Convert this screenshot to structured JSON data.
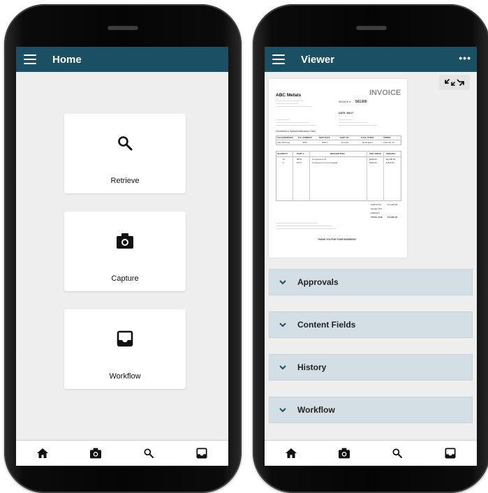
{
  "left_phone": {
    "appbar": {
      "title": "Home"
    },
    "tiles": [
      {
        "label": "Retrieve",
        "icon": "search-icon"
      },
      {
        "label": "Capture",
        "icon": "camera-icon"
      },
      {
        "label": "Workflow",
        "icon": "inbox-icon"
      }
    ],
    "bottom_nav": [
      "home-icon",
      "camera-icon",
      "search-icon",
      "inbox-icon"
    ]
  },
  "right_phone": {
    "appbar": {
      "title": "Viewer",
      "more": "•••"
    },
    "invoice": {
      "company": "ABC Metals",
      "heading": "INVOICE",
      "invoice_label": "INVOICE #:",
      "invoice_no": "561300",
      "date_label": "DATE: 9/6/17",
      "comments": "Comments or Special Instructions: None",
      "headers": [
        "SALESPERSON",
        "P.O. NUMBER",
        "SHIP DATE",
        "SHIP VIA",
        "F.O.B. POINT",
        "TERMS"
      ],
      "row": [
        "Alan McInnes",
        "4356",
        "9/6/17",
        "Ground",
        "Destination",
        "2/10 Net 30"
      ],
      "line_headers": [
        "QUANTITY",
        "PART #",
        "DESCRIPTION",
        "UNIT PRICE",
        "AMOUNT"
      ],
      "lines": [
        [
          "10",
          "88C5",
          "Component C3",
          "$250.00",
          "$2,500.00"
        ],
        [
          "5",
          "57C7",
          "Component C7 Lot Treated",
          "$160.00",
          "$ 800.00"
        ]
      ],
      "totals": [
        {
          "label": "SUBTOTAL",
          "value": "$ 3,300.00"
        },
        {
          "label": "SALES TAX",
          "value": ""
        },
        {
          "label": "FREIGHT",
          "value": ""
        },
        {
          "label": "TOTAL DUE",
          "value": "$ 3,300.00"
        }
      ],
      "thanks": "THANK YOU FOR YOUR BUSINESS!"
    },
    "accordions": [
      {
        "label": "Approvals"
      },
      {
        "label": "Content Fields"
      },
      {
        "label": "History"
      },
      {
        "label": "Workflow"
      }
    ],
    "bottom_nav": [
      "home-icon",
      "camera-icon",
      "search-icon",
      "inbox-icon"
    ]
  },
  "colors": {
    "appbar": "#1b4f63",
    "accordion": "#d3dfe4",
    "screen_bg": "#eeeeee"
  }
}
